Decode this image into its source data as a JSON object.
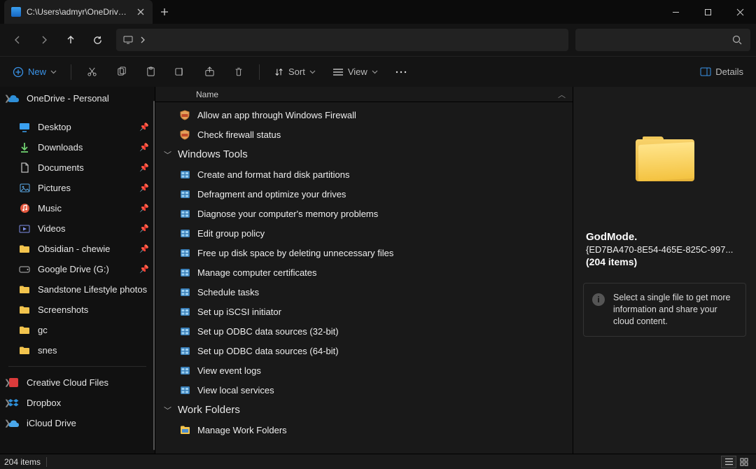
{
  "tab": {
    "title": "C:\\Users\\admyr\\OneDrive\\Des"
  },
  "toolbar": {
    "new": "New",
    "sort": "Sort",
    "view": "View",
    "details": "Details"
  },
  "col_header": "Name",
  "sidebar": {
    "onedrive": "OneDrive - Personal",
    "quick": [
      {
        "label": "Desktop",
        "icon": "desktop"
      },
      {
        "label": "Downloads",
        "icon": "downloads"
      },
      {
        "label": "Documents",
        "icon": "documents"
      },
      {
        "label": "Pictures",
        "icon": "pictures"
      },
      {
        "label": "Music",
        "icon": "music"
      },
      {
        "label": "Videos",
        "icon": "videos"
      },
      {
        "label": "Obsidian - chewie",
        "icon": "folder"
      },
      {
        "label": "Google Drive (G:)",
        "icon": "drive"
      },
      {
        "label": "Sandstone Lifestyle photos",
        "icon": "folder"
      },
      {
        "label": "Screenshots",
        "icon": "folder"
      },
      {
        "label": "gc",
        "icon": "folder"
      },
      {
        "label": "snes",
        "icon": "folder"
      }
    ],
    "cloud": [
      {
        "label": "Creative Cloud Files",
        "icon": "cc"
      },
      {
        "label": "Dropbox",
        "icon": "dropbox"
      },
      {
        "label": "iCloud Drive",
        "icon": "icloud"
      }
    ]
  },
  "firewall_items": [
    "Allow an app through Windows Firewall",
    "Check firewall status"
  ],
  "groups": [
    {
      "name": "Windows Tools",
      "items": [
        "Create and format hard disk partitions",
        "Defragment and optimize your drives",
        "Diagnose your computer's memory problems",
        "Edit group policy",
        "Free up disk space by deleting unnecessary files",
        "Manage computer certificates",
        "Schedule tasks",
        "Set up iSCSI initiator",
        "Set up ODBC data sources (32-bit)",
        "Set up ODBC data sources (64-bit)",
        "View event logs",
        "View local services"
      ]
    },
    {
      "name": "Work Folders",
      "items": [
        "Manage Work Folders"
      ]
    }
  ],
  "details": {
    "title": "GodMode.",
    "guid": "{ED7BA470-8E54-465E-825C-997...",
    "count": "(204 items)",
    "tip": "Select a single file to get more information and share your cloud content."
  },
  "status": {
    "count": "204 items"
  }
}
